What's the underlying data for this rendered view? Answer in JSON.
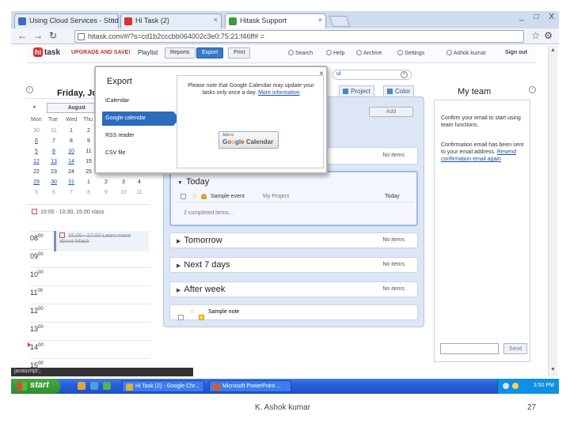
{
  "browser": {
    "tabs": [
      {
        "label": "Using Cloud Services - Student",
        "color": "#3b6cc8"
      },
      {
        "label": "Hi Task (2)",
        "color": "#d9322f"
      },
      {
        "label": "Hitask Support",
        "color": "#3f9b3f"
      }
    ],
    "address": "hitask.com/#/?s=cd1b2cccbb064002c3e0:75:21:f46ff# =",
    "window_controls": [
      "_",
      "□",
      "X"
    ]
  },
  "app": {
    "logo": "task",
    "logo_badge": "hi",
    "upgrade": "UPGRADE AND SAVE!",
    "nav": {
      "playlist": "Playlist",
      "reports": "Reports",
      "export": "Export",
      "print": "Print"
    },
    "links": {
      "search": "Search",
      "help": "Help",
      "archive": "Archive",
      "settings": "Settings"
    },
    "user": "Ashok kumar",
    "signout": "Sign out"
  },
  "calendar": {
    "day_title": "Friday, Ju",
    "month": "August",
    "weekdays": [
      "Mon",
      "Tue",
      "Wed",
      "Thu"
    ],
    "weeks": [
      [
        {
          "t": "30",
          "s": "g"
        },
        {
          "t": "31",
          "s": "g"
        },
        {
          "t": "1",
          "s": ""
        },
        {
          "t": "2",
          "s": ""
        }
      ],
      [
        {
          "t": "6",
          "s": "u"
        },
        {
          "t": "7",
          "s": ""
        },
        {
          "t": "8",
          "s": ""
        },
        {
          "t": "9",
          "s": ""
        }
      ],
      [
        {
          "t": "5",
          "s": "u"
        },
        {
          "t": "8",
          "s": "u"
        },
        {
          "t": "10",
          "s": "u"
        },
        {
          "t": "11",
          "s": ""
        },
        {
          "t": "",
          "s": ""
        },
        {
          "t": "",
          "s": ""
        },
        {
          "t": "",
          "s": ""
        }
      ],
      [
        {
          "t": "12",
          "s": "u"
        },
        {
          "t": "13",
          "s": "u"
        },
        {
          "t": "14",
          "s": "u"
        },
        {
          "t": "15",
          "s": ""
        }
      ],
      [
        {
          "t": "22",
          "s": ""
        },
        {
          "t": "23",
          "s": ""
        },
        {
          "t": "24",
          "s": ""
        },
        {
          "t": "25",
          "s": ""
        }
      ],
      [
        {
          "t": "29",
          "s": "u"
        },
        {
          "t": "30",
          "s": "u"
        },
        {
          "t": "31",
          "s": "u"
        },
        {
          "t": "1",
          "s": ""
        },
        {
          "t": "2",
          "s": ""
        },
        {
          "t": "3",
          "s": ""
        },
        {
          "t": "4",
          "s": ""
        }
      ],
      [
        {
          "t": "5",
          "s": "g"
        },
        {
          "t": "6",
          "s": "g"
        },
        {
          "t": "7",
          "s": "g"
        },
        {
          "t": "8",
          "s": "g"
        },
        {
          "t": "9",
          "s": "g"
        },
        {
          "t": "10",
          "s": "g"
        },
        {
          "t": "11",
          "s": "g"
        }
      ]
    ],
    "event_strip": "10:00 - 10:30, 15:00 class",
    "hours": [
      "08",
      "09",
      "10",
      "11",
      "12",
      "13",
      "14",
      "15"
    ],
    "hour_suffix": "00",
    "event": "15:00 - 17:00 Learn more about hitask"
  },
  "tooltip": "javascript:;",
  "export_popup": {
    "title": "Export",
    "close": "×",
    "items": [
      "iCalendar",
      "Google calendar",
      "RSS reader",
      "CSV file"
    ],
    "selected": 1,
    "note": "Please note that Google Calendar may update your tasks only once a day.",
    "more_info": "More information",
    "gcal_small": "Add to",
    "gcal_label": "Google Calendar"
  },
  "main": {
    "search_value": "ul",
    "tabs": [
      "Project",
      "Color"
    ],
    "add_button": "Add",
    "sections": [
      {
        "title": "",
        "count": "No items"
      },
      {
        "title": "Today",
        "count": ""
      },
      {
        "title": "Tomorrow",
        "count": "No items"
      },
      {
        "title": "Next 7 days",
        "count": "No items"
      },
      {
        "title": "After week",
        "count": "No items"
      }
    ],
    "today_task": {
      "name": "Sample event",
      "project": "My Project",
      "when": "Today"
    },
    "completed": "2 completed items...",
    "note_task": "Sample note"
  },
  "team": {
    "title": "My team",
    "text1": "Confirm your email to start using team functions.",
    "text2": "Confirmation email has been sent to your email address.",
    "resend": "Resend confirmation email again",
    "send_label": "Send"
  },
  "taskbar": {
    "start": "start",
    "tasks": [
      "Hi Task (2) - Google Chr...",
      "Microsoft PowerPoint ..."
    ],
    "clock": "3:50 PM"
  },
  "footer": {
    "author": "K. Ashok kumar",
    "page": "27"
  }
}
